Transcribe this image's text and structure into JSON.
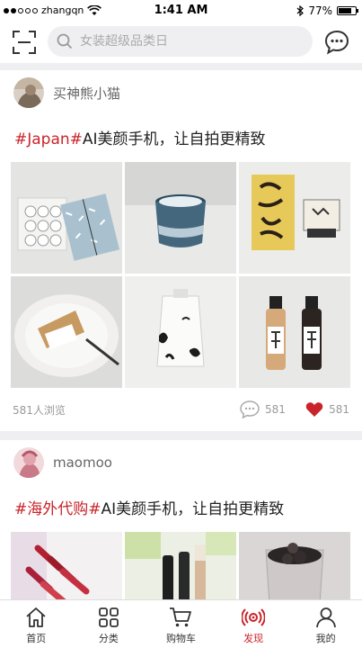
{
  "status_bar": {
    "carrier": "zhangqn",
    "time": "1:41 AM",
    "battery": "77%",
    "battery_level": 0.77
  },
  "header": {
    "search_placeholder": "女装超级品类日",
    "icons": {
      "scan": "scan-icon",
      "search": "search-icon",
      "messages": "chat-bubble-icon"
    }
  },
  "posts": [
    {
      "author": "买神熊小猫",
      "tag": "#Japan#",
      "text": "AI美颜手机，让自拍更精致",
      "views": "581人浏览",
      "comments": "581",
      "likes": "581"
    },
    {
      "author": "maomoo",
      "tag": "#海外代购#",
      "text": "AI美颜手机，让自拍更精致"
    }
  ],
  "tabs": [
    {
      "label": "首页",
      "icon": "home-icon"
    },
    {
      "label": "分类",
      "icon": "grid-icon"
    },
    {
      "label": "购物车",
      "icon": "cart-icon"
    },
    {
      "label": "发现",
      "icon": "discover-icon",
      "active": true
    },
    {
      "label": "我的",
      "icon": "user-icon"
    }
  ],
  "colors": {
    "accent": "#c8242a",
    "background": "#efeff2"
  }
}
